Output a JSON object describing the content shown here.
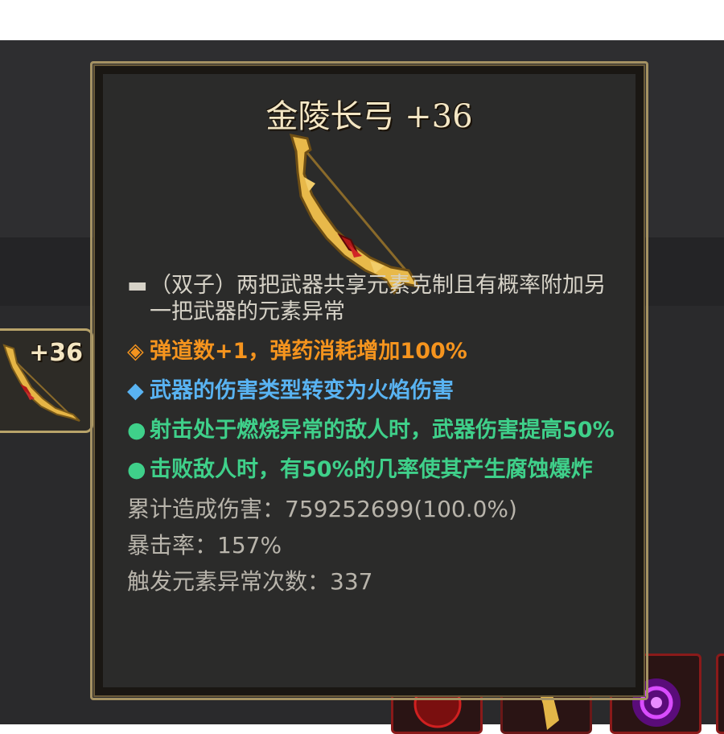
{
  "slot": {
    "level": "+36"
  },
  "tooltip": {
    "title": "金陵长弓 +36",
    "lines": [
      {
        "bullet": "▬",
        "text": "（双子）两把武器共享元素克制且有概率附加另一把武器的元素异常"
      },
      {
        "bullet": "◈",
        "text": "弹道数+1，弹药消耗增加100%"
      },
      {
        "bullet": "◆",
        "text": "武器的伤害类型转变为火焰伤害"
      },
      {
        "bullet": "●",
        "text": "射击处于燃烧异常的敌人时，武器伤害提高50%"
      },
      {
        "bullet": "●",
        "text": "击败敌人时，有50%的几率使其产生腐蚀爆炸"
      }
    ],
    "stats": [
      "累计造成伤害：759252699(100.0%)",
      "暴击率：157%",
      "触发元素异常次数：337"
    ]
  },
  "colors": {
    "orange": "#f5941e",
    "blue": "#59b3f2",
    "green": "#3fd08a",
    "gold": "#e8b94a"
  }
}
